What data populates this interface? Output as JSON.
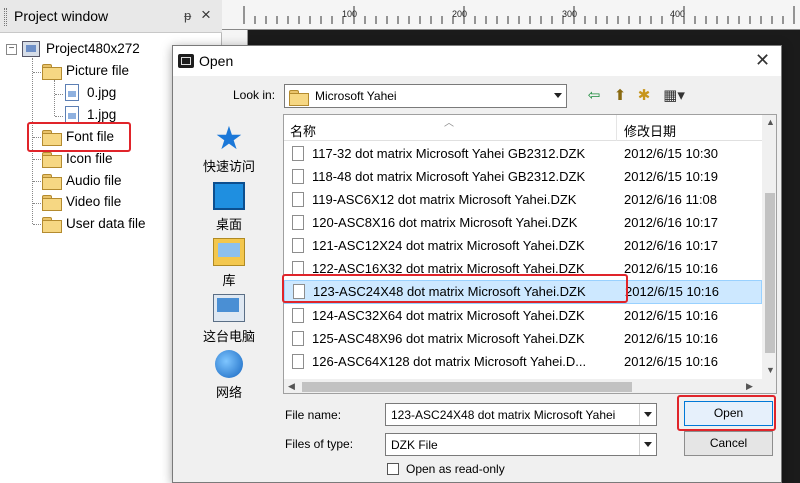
{
  "project_window": {
    "title": "Project window",
    "pin_glyph": "ᵽ",
    "close_glyph": "×",
    "tree": {
      "root": "Project480x272",
      "picture_folder": "Picture file",
      "pictures": [
        "0.jpg",
        "1.jpg"
      ],
      "folders": [
        "Font file",
        "Icon file",
        "Audio file",
        "Video file",
        "User data file"
      ]
    }
  },
  "ruler": {
    "marks": [
      "100",
      "200",
      "300",
      "400"
    ]
  },
  "dialog": {
    "title": "Open",
    "close_glyph": "✕",
    "look_in_label": "Look in:",
    "look_in_value": "Microsoft Yahei",
    "toolbar": {
      "back": "⇦",
      "up_folder": "⬆",
      "new_folder": "✱",
      "view_menu": "▦▾"
    },
    "places": [
      "快速访问",
      "桌面",
      "库",
      "这台电脑",
      "网络"
    ],
    "columns": {
      "name": "名称",
      "date": "修改日期"
    },
    "files": [
      {
        "name": "117-32 dot matrix Microsoft Yahei GB2312.DZK",
        "date": "2012/6/15 10:30"
      },
      {
        "name": "118-48 dot matrix Microsoft Yahei GB2312.DZK",
        "date": "2012/6/15 10:19"
      },
      {
        "name": "119-ASC6X12 dot matrix Microsoft Yahei.DZK",
        "date": "2012/6/16 11:08"
      },
      {
        "name": "120-ASC8X16 dot matrix Microsoft Yahei.DZK",
        "date": "2012/6/16 10:17"
      },
      {
        "name": "121-ASC12X24 dot matrix Microsoft Yahei.DZK",
        "date": "2012/6/16 10:17"
      },
      {
        "name": "122-ASC16X32 dot matrix Microsoft Yahei.DZK",
        "date": "2012/6/15 10:16"
      },
      {
        "name": "123-ASC24X48 dot matrix Microsoft Yahei.DZK",
        "date": "2012/6/15 10:16"
      },
      {
        "name": "124-ASC32X64 dot matrix Microsoft Yahei.DZK",
        "date": "2012/6/15 10:16"
      },
      {
        "name": "125-ASC48X96 dot matrix Microsoft Yahei.DZK",
        "date": "2012/6/15 10:16"
      },
      {
        "name": "126-ASC64X128 dot matrix Microsoft Yahei.D...",
        "date": "2012/6/15 10:16"
      }
    ],
    "file_name_label": "File name:",
    "file_name_value": "123-ASC24X48 dot matrix Microsoft Yahei",
    "files_of_type_label": "Files of type:",
    "files_of_type_value": "DZK File",
    "read_only_label": "Open as read-only",
    "open_button": "Open",
    "cancel_button": "Cancel"
  },
  "colors": {
    "highlight_red": "#e0242a",
    "selection": "#cde8ff",
    "accent": "#0078d7"
  }
}
